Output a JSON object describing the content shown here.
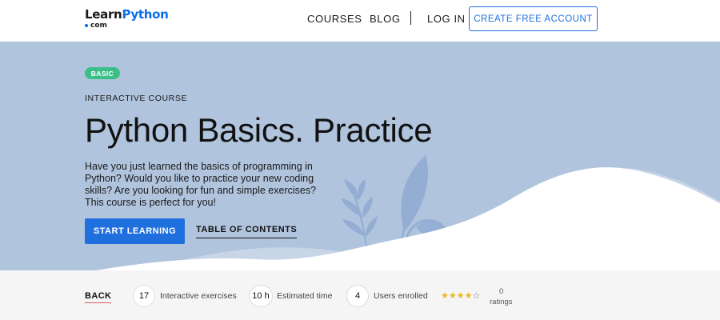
{
  "header": {
    "logo_main_prefix": "Learn",
    "logo_main_accent": "Python",
    "logo_sub": "com",
    "nav": {
      "courses": "COURSES",
      "blog": "BLOG",
      "login": "LOG IN"
    },
    "cta_label": "CREATE FREE ACCOUNT"
  },
  "hero": {
    "badge": "BASIC",
    "eyebrow": "INTERACTIVE COURSE",
    "title": "Python Basics. Practice",
    "description": "Have you just learned the basics of programming in Python? Would you like to practice your new coding skills? Are you looking for fun and simple exercises? This course is perfect for you!",
    "start_button": "START LEARNING",
    "toc_link": "TABLE OF CONTENTS",
    "colors": {
      "background": "#b0c4dd",
      "leaf": "#93add3",
      "primary": "#1f6fde",
      "badge": "#3cbf87"
    }
  },
  "stats": {
    "back": "BACK",
    "exercises_value": "17",
    "exercises_label": "Interactive exercises",
    "time_value": "10 h",
    "time_label": "Estimated time",
    "users_value": "4",
    "users_label": "Users enrolled",
    "rating": {
      "stars_full": 3,
      "stars_half": 1,
      "stars_max": 5
    },
    "ratings_count": "0",
    "ratings_label": "ratings"
  }
}
